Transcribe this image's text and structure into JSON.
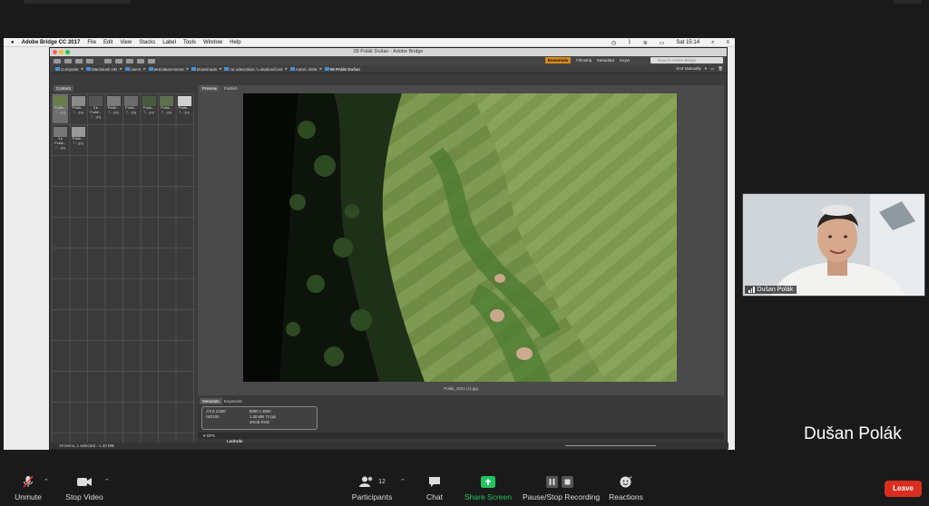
{
  "mac_menu": {
    "apple": "",
    "app_name": "Adobe Bridge CC 2017",
    "items": [
      "File",
      "Edit",
      "View",
      "Stacks",
      "Label",
      "Tools",
      "Window",
      "Help"
    ],
    "clock": "Sat 15:14"
  },
  "bridge": {
    "window_title": "09 Polák Dušan - Adobe Bridge",
    "workspaces": [
      "Essentials",
      "Filmstrip",
      "Metadata",
      "Keyw"
    ],
    "active_workspace": "Essentials",
    "search_placeholder": "Search Adobe Bridge",
    "breadcrumb": [
      "Computer",
      "Macintosh HD",
      "Users",
      "terezakacmirova",
      "Downloads",
      "na odevzdání / Lukašovičová",
      "Autori, diela",
      "09 Polák Dušan"
    ],
    "sort_label": "Sort Manually",
    "content_tab": "Content",
    "preview_tab": "Preview",
    "publish_tab": "Publish",
    "thumbnails": [
      {
        "l1": "Polák...",
        "l2": "7....jpg",
        "selected": true
      },
      {
        "l1": "Polák...",
        "l2": "7....jpg",
        "selected": false
      },
      {
        "l1": "Polák...",
        "l2": "7....jpg",
        "selected": false,
        "badge": "3 ▸"
      },
      {
        "l1": "Polák...",
        "l2": "7....jpg",
        "selected": false
      },
      {
        "l1": "Polák...",
        "l2": "7....jpg",
        "selected": false
      },
      {
        "l1": "Polák...",
        "l2": "7....jpg",
        "selected": false
      },
      {
        "l1": "Polák...",
        "l2": "7....jpg",
        "selected": false
      },
      {
        "l1": "Polák...",
        "l2": "7....jpg",
        "selected": false
      },
      {
        "l1": "Polák...",
        "l2": "7....jpg",
        "selected": false,
        "badge": "3 ▸"
      },
      {
        "l1": "Polák...",
        "l2": "7....jpg",
        "selected": false
      }
    ],
    "preview_filename": "Polák_2021 (1).jpg",
    "meta_tabs": [
      "Metadata",
      "Keywords"
    ],
    "meta_box": {
      "aperture": "ƒ/2.8",
      "shutter": "1/300",
      "dims": "5000 x 3500",
      "size": "1.30 MB",
      "ppi": "72 ppi",
      "colorspace": "sRGB",
      "mode": "RGB",
      "iso": "ISO100"
    },
    "gps_label": "GPS",
    "latitude_label": "Latitude",
    "status": "10 items, 1 selected - 1.30 MB"
  },
  "participant": {
    "tile_name": "Dušan Polák",
    "big_name": "Dušan Polák"
  },
  "controls": {
    "unmute": "Unmute",
    "stop_video": "Stop Video",
    "participants": "Participants",
    "participants_count": "12",
    "chat": "Chat",
    "share_screen": "Share Screen",
    "record": "Pause/Stop Recording",
    "reactions": "Reactions",
    "leave": "Leave"
  },
  "colors": {
    "share_green": "#22c55e",
    "leave_red": "#d92d20",
    "workspace_accent": "#d78b1b"
  }
}
